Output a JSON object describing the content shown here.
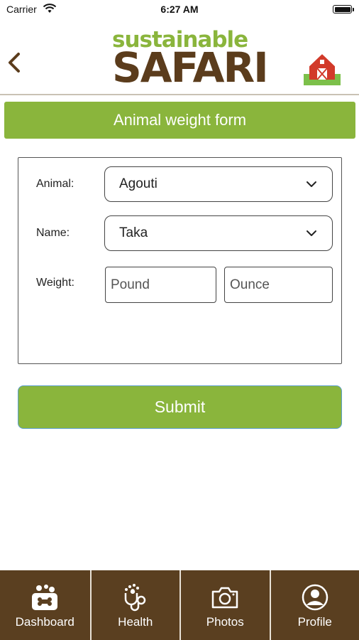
{
  "status_bar": {
    "carrier": "Carrier",
    "time": "6:27 AM"
  },
  "header": {
    "logo_top": "sustainable",
    "logo_bottom": "SAFARI",
    "back_icon": "chevron-left-icon",
    "farm_icon": "barn-icon"
  },
  "form": {
    "title": "Animal weight form",
    "animal_label": "Animal:",
    "animal_value": "Agouti",
    "name_label": "Name:",
    "name_value": "Taka",
    "weight_label": "Weight:",
    "pound_placeholder": "Pound",
    "ounce_placeholder": "Ounce",
    "submit_label": "Submit"
  },
  "tab_bar": {
    "tabs": [
      {
        "label": "Dashboard",
        "icon": "dashboard-icon"
      },
      {
        "label": "Health",
        "icon": "stethoscope-icon"
      },
      {
        "label": "Photos",
        "icon": "camera-icon"
      },
      {
        "label": "Profile",
        "icon": "profile-icon"
      }
    ]
  },
  "colors": {
    "accent_green": "#8ab53c",
    "brand_brown": "#5b3c1c",
    "tab_bar_brown": "#5a3f20"
  }
}
